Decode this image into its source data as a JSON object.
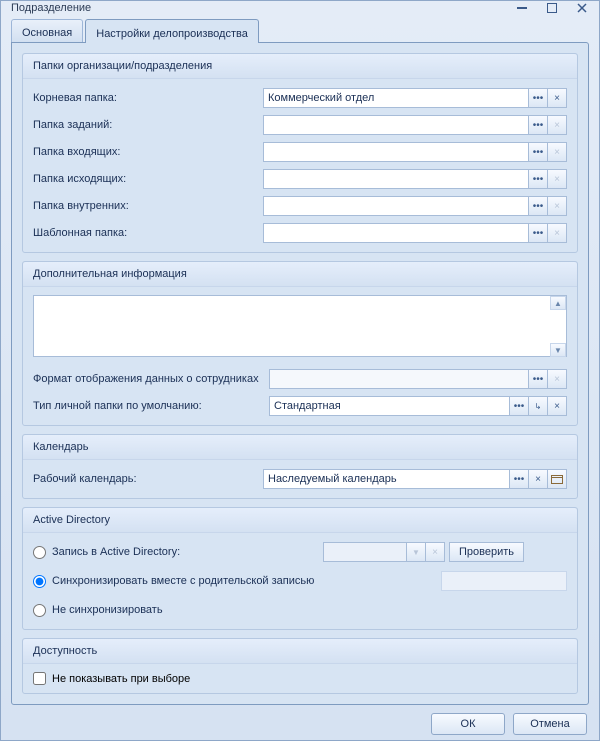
{
  "window": {
    "title": "Подразделение"
  },
  "tabs": [
    {
      "label": "Основная"
    },
    {
      "label": "Настройки делопроизводства"
    }
  ],
  "groups": {
    "folders": {
      "title": "Папки организации/подразделения",
      "rows": {
        "root": {
          "label": "Корневая папка:",
          "value": "Коммерческий отдел"
        },
        "tasks": {
          "label": "Папка заданий:",
          "value": ""
        },
        "incoming": {
          "label": "Папка входящих:",
          "value": ""
        },
        "outgoing": {
          "label": "Папка исходящих:",
          "value": ""
        },
        "internal": {
          "label": "Папка внутренних:",
          "value": ""
        },
        "template": {
          "label": "Шаблонная папка:",
          "value": ""
        }
      }
    },
    "additional": {
      "title": "Дополнительная информация",
      "text": "",
      "emp_format": {
        "label": "Формат отображения данных о сотрудниках",
        "value": ""
      },
      "folder_type": {
        "label": "Тип личной папки по умолчанию:",
        "value": "Стандартная"
      }
    },
    "calendar": {
      "title": "Календарь",
      "work": {
        "label": "Рабочий календарь:",
        "value": "Наследуемый календарь"
      }
    },
    "ad": {
      "title": "Active Directory",
      "opt1": "Запись в Active Directory:",
      "opt2": "Синхронизировать вместе с родительской записью",
      "opt3": "Не синхронизировать",
      "check_btn": "Проверить"
    },
    "availability": {
      "title": "Доступность",
      "hide_label": "Не показывать при выборе"
    }
  },
  "buttons": {
    "ok": "ОК",
    "cancel": "Отмена"
  },
  "icons": {
    "dots": "•••",
    "x": "×",
    "down": "▼",
    "arrow": "↳"
  }
}
